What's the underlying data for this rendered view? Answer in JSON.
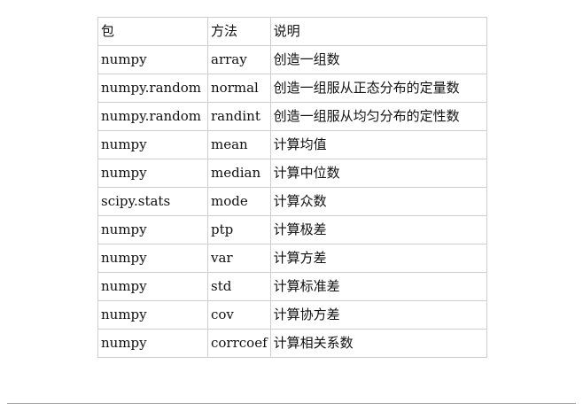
{
  "table": {
    "header": {
      "package": "包",
      "method": "方法",
      "description": "说明"
    },
    "rows": [
      {
        "package": "numpy",
        "method": "array",
        "description": "创造一组数"
      },
      {
        "package": "numpy.random",
        "method": "normal",
        "description": "创造一组服从正态分布的定量数"
      },
      {
        "package": "numpy.random",
        "method": "randint",
        "description": "创造一组服从均匀分布的定性数"
      },
      {
        "package": "numpy",
        "method": "mean",
        "description": "计算均值"
      },
      {
        "package": "numpy",
        "method": "median",
        "description": "计算中位数"
      },
      {
        "package": "scipy.stats",
        "method": "mode",
        "description": "计算众数"
      },
      {
        "package": "numpy",
        "method": "ptp",
        "description": "计算极差"
      },
      {
        "package": "numpy",
        "method": "var",
        "description": "计算方差"
      },
      {
        "package": "numpy",
        "method": "std",
        "description": "计算标准差"
      },
      {
        "package": "numpy",
        "method": "cov",
        "description": "计算协方差"
      },
      {
        "package": "numpy",
        "method": "corrcoef",
        "description": "计算相关系数"
      }
    ]
  },
  "colors": {
    "border": "#cfcfcf",
    "text": "#111111",
    "divider": "#a9a9a9"
  }
}
